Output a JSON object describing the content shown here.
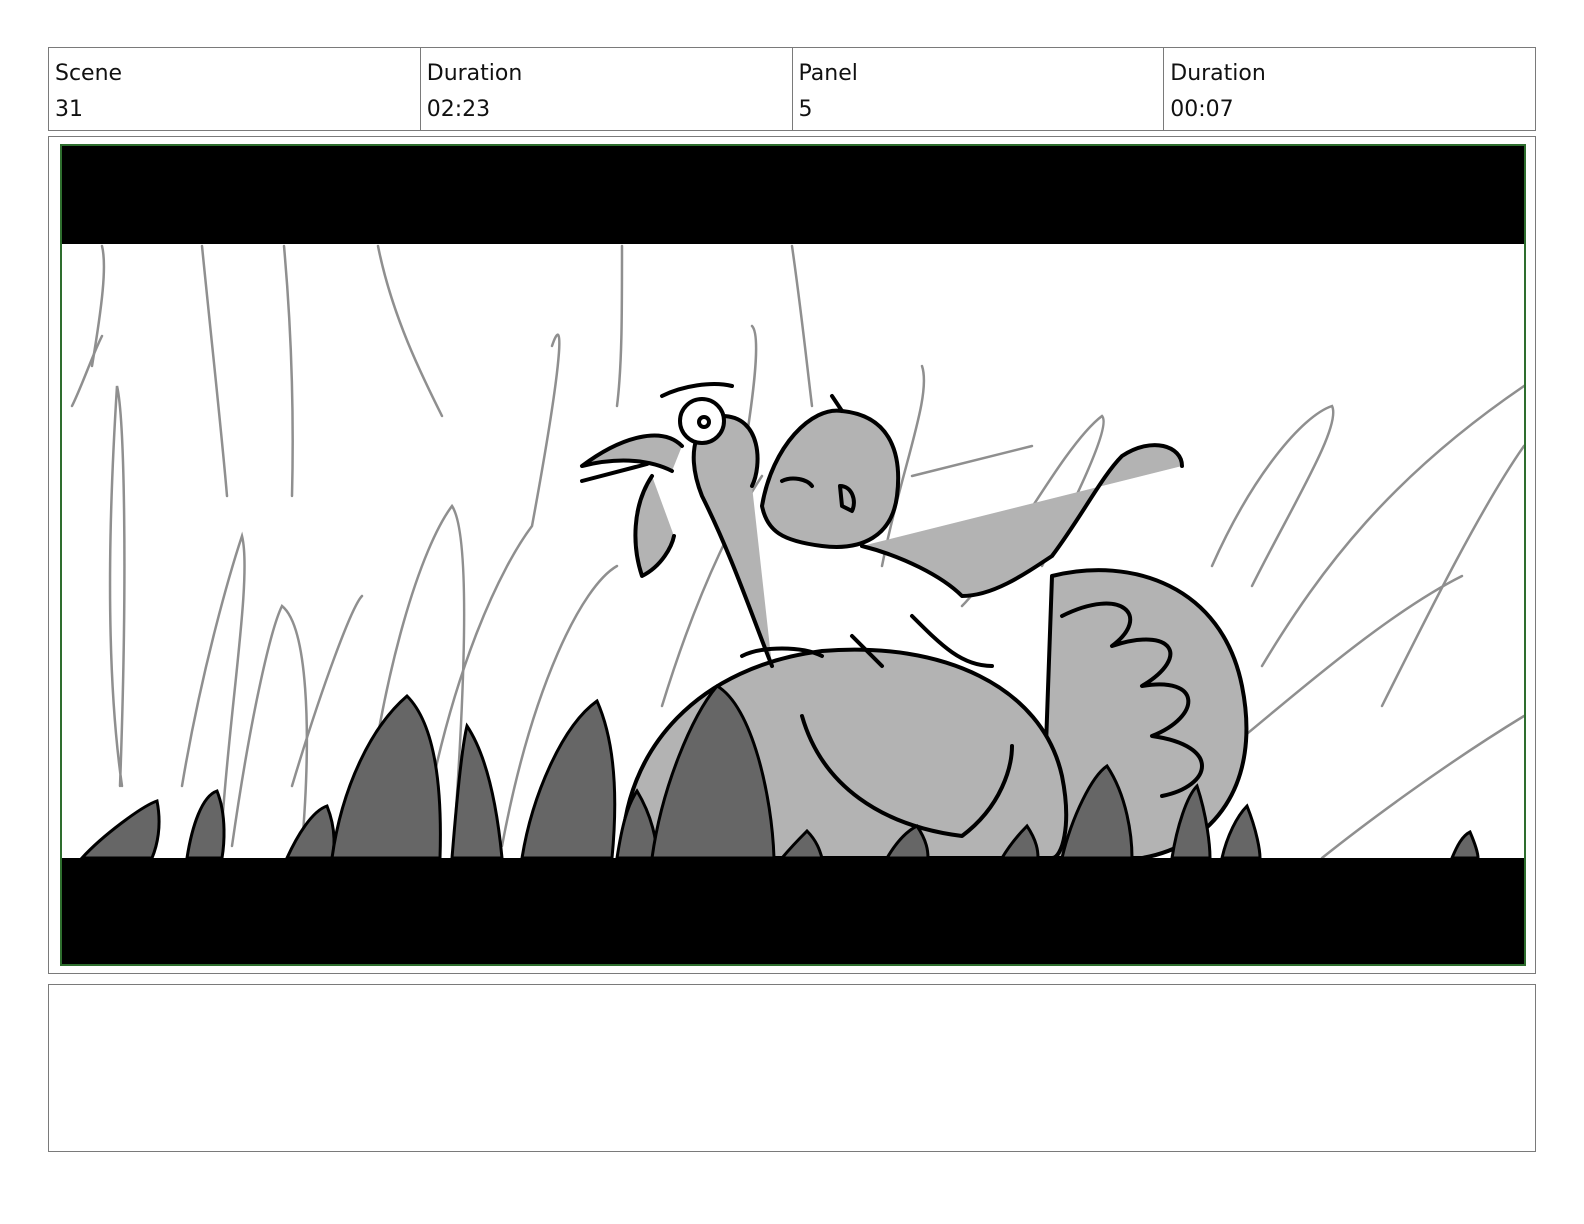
{
  "header": {
    "scene_label": "Scene",
    "scene_value": "31",
    "scene_duration_label": "Duration",
    "scene_duration_value": "02:23",
    "panel_label": "Panel",
    "panel_value": "5",
    "panel_duration_label": "Duration",
    "panel_duration_value": "00:07"
  },
  "notes": {
    "text": ""
  },
  "colors": {
    "frame_border": "#2e6e2e",
    "letterbox": "#000000",
    "fill_light": "#b3b3b3",
    "fill_dark": "#666666",
    "grass_line": "#8f8f8f"
  }
}
